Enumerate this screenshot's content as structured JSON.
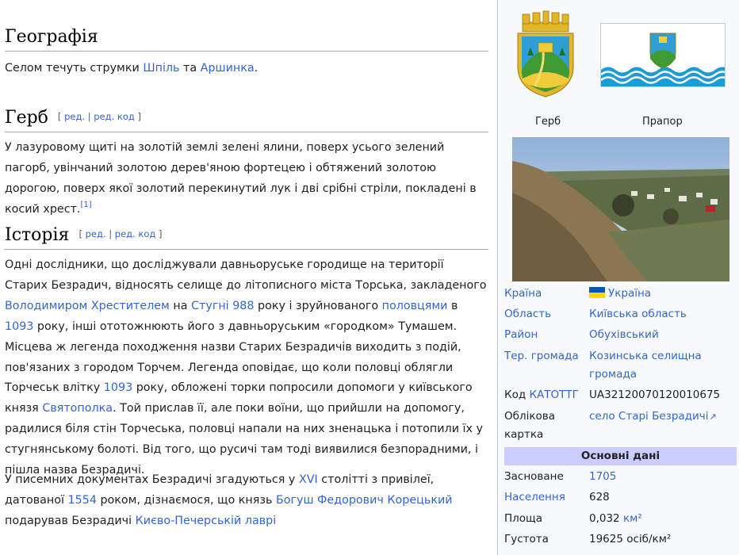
{
  "geography": {
    "heading": "Географія",
    "text_prefix": "Селом течуть струмки ",
    "link1": "Шпіль",
    "text_mid": " та ",
    "link2": "Аршинка",
    "text_suffix": "."
  },
  "herb": {
    "heading": "Герб",
    "edit_open": "[",
    "edit_label": "ред.",
    "edit_sep": "|",
    "edit_code_label": "ред. код",
    "edit_close": "]",
    "text": "У лазуровому щиті на золотій землі зелені ялини, поверх усього зелений пагорб, увінчаний золотою дерев'яною фортецею і обтяжений золотою дорогою, поверх якої золотий перекинутий лук і дві срібні стріли, покладені в косий хрест.",
    "ref": "[1]"
  },
  "history": {
    "heading": "Історія",
    "edit_open": "[",
    "edit_label": "ред.",
    "edit_sep": "|",
    "edit_code_label": "ред. код",
    "edit_close": "]",
    "p1": {
      "t1": "Одні дослідники, що досліджували давньоруське городище на території Старих Безрадич, відносять селище до літописного міста Торська, закладеного ",
      "l1": "Володимиром Хрестителем",
      "t2": " на ",
      "l2": "Стугні",
      "t3": " ",
      "l3": "988",
      "t4": " року і зруйнованого ",
      "l4": "половцями",
      "t5": " в ",
      "l5": "1093",
      "t6": " року, інші ототожнюють його з давньоруським «городком» Тумашем. Місцева ж легенда походження назви Старих Безрадичів виходить з подій, пов'язаних з городом Торчем. Легенда оповідає, що коли половці облягли Торчеськ влітку ",
      "l6": "1093",
      "t7": " року, обложені торки попросили допомоги у київського князя ",
      "l7": "Святополка",
      "t8": ". Той прислав її, але поки воїни, що прийшли на допомогу, радилися біля стін Торчеська, половці напали на них зненацька і потопили їх у стугнянському болоті. Від того, що русичі там тоді виявилися безпорадними, і пішла назва Безрадичі."
    },
    "p2": {
      "t1": "У писемних документах Безрадичі згадуються у ",
      "l1": "XVI",
      "t2": " столітті з привілеї, датованої ",
      "l2": "1554",
      "t3": " роком, дізнаємося, що князь ",
      "l3": "Богуш Федорович Корецький",
      "t4": " подарував Безрадичі ",
      "l4": "Києво-Печерській лаврі"
    }
  },
  "infobox": {
    "coat_caption": "Герб",
    "flag_caption": "Прапор",
    "rows": [
      {
        "label": "Країна",
        "value": "Україна"
      },
      {
        "label": "Область",
        "value": "Київська область"
      },
      {
        "label": "Район",
        "value": "Обухівський"
      },
      {
        "label": "Тер. громада",
        "value": "Козинська селищна громада"
      },
      {
        "label_prefix": "Код ",
        "label_link": "КАТОТТГ",
        "value": "UA32120070120010675"
      },
      {
        "label": "Облікова картка",
        "value": "село Старі Безрадичі"
      }
    ],
    "section_title": "Основні дані",
    "rows2": [
      {
        "label": "Засноване",
        "value": "1705"
      },
      {
        "label": "Населення",
        "value": "628"
      },
      {
        "label": "Площа",
        "value": "0,032",
        "unit": "км²"
      },
      {
        "label": "Густота",
        "value": "19625 осіб/км²"
      }
    ]
  },
  "colors": {
    "link": "#3366cc",
    "infobox_bg": "#f8f9fa",
    "section_bg": "#ccccff",
    "flag_blue": "#1e9bd7",
    "ukraine_blue": "#0057b7",
    "ukraine_yellow": "#ffd700"
  }
}
